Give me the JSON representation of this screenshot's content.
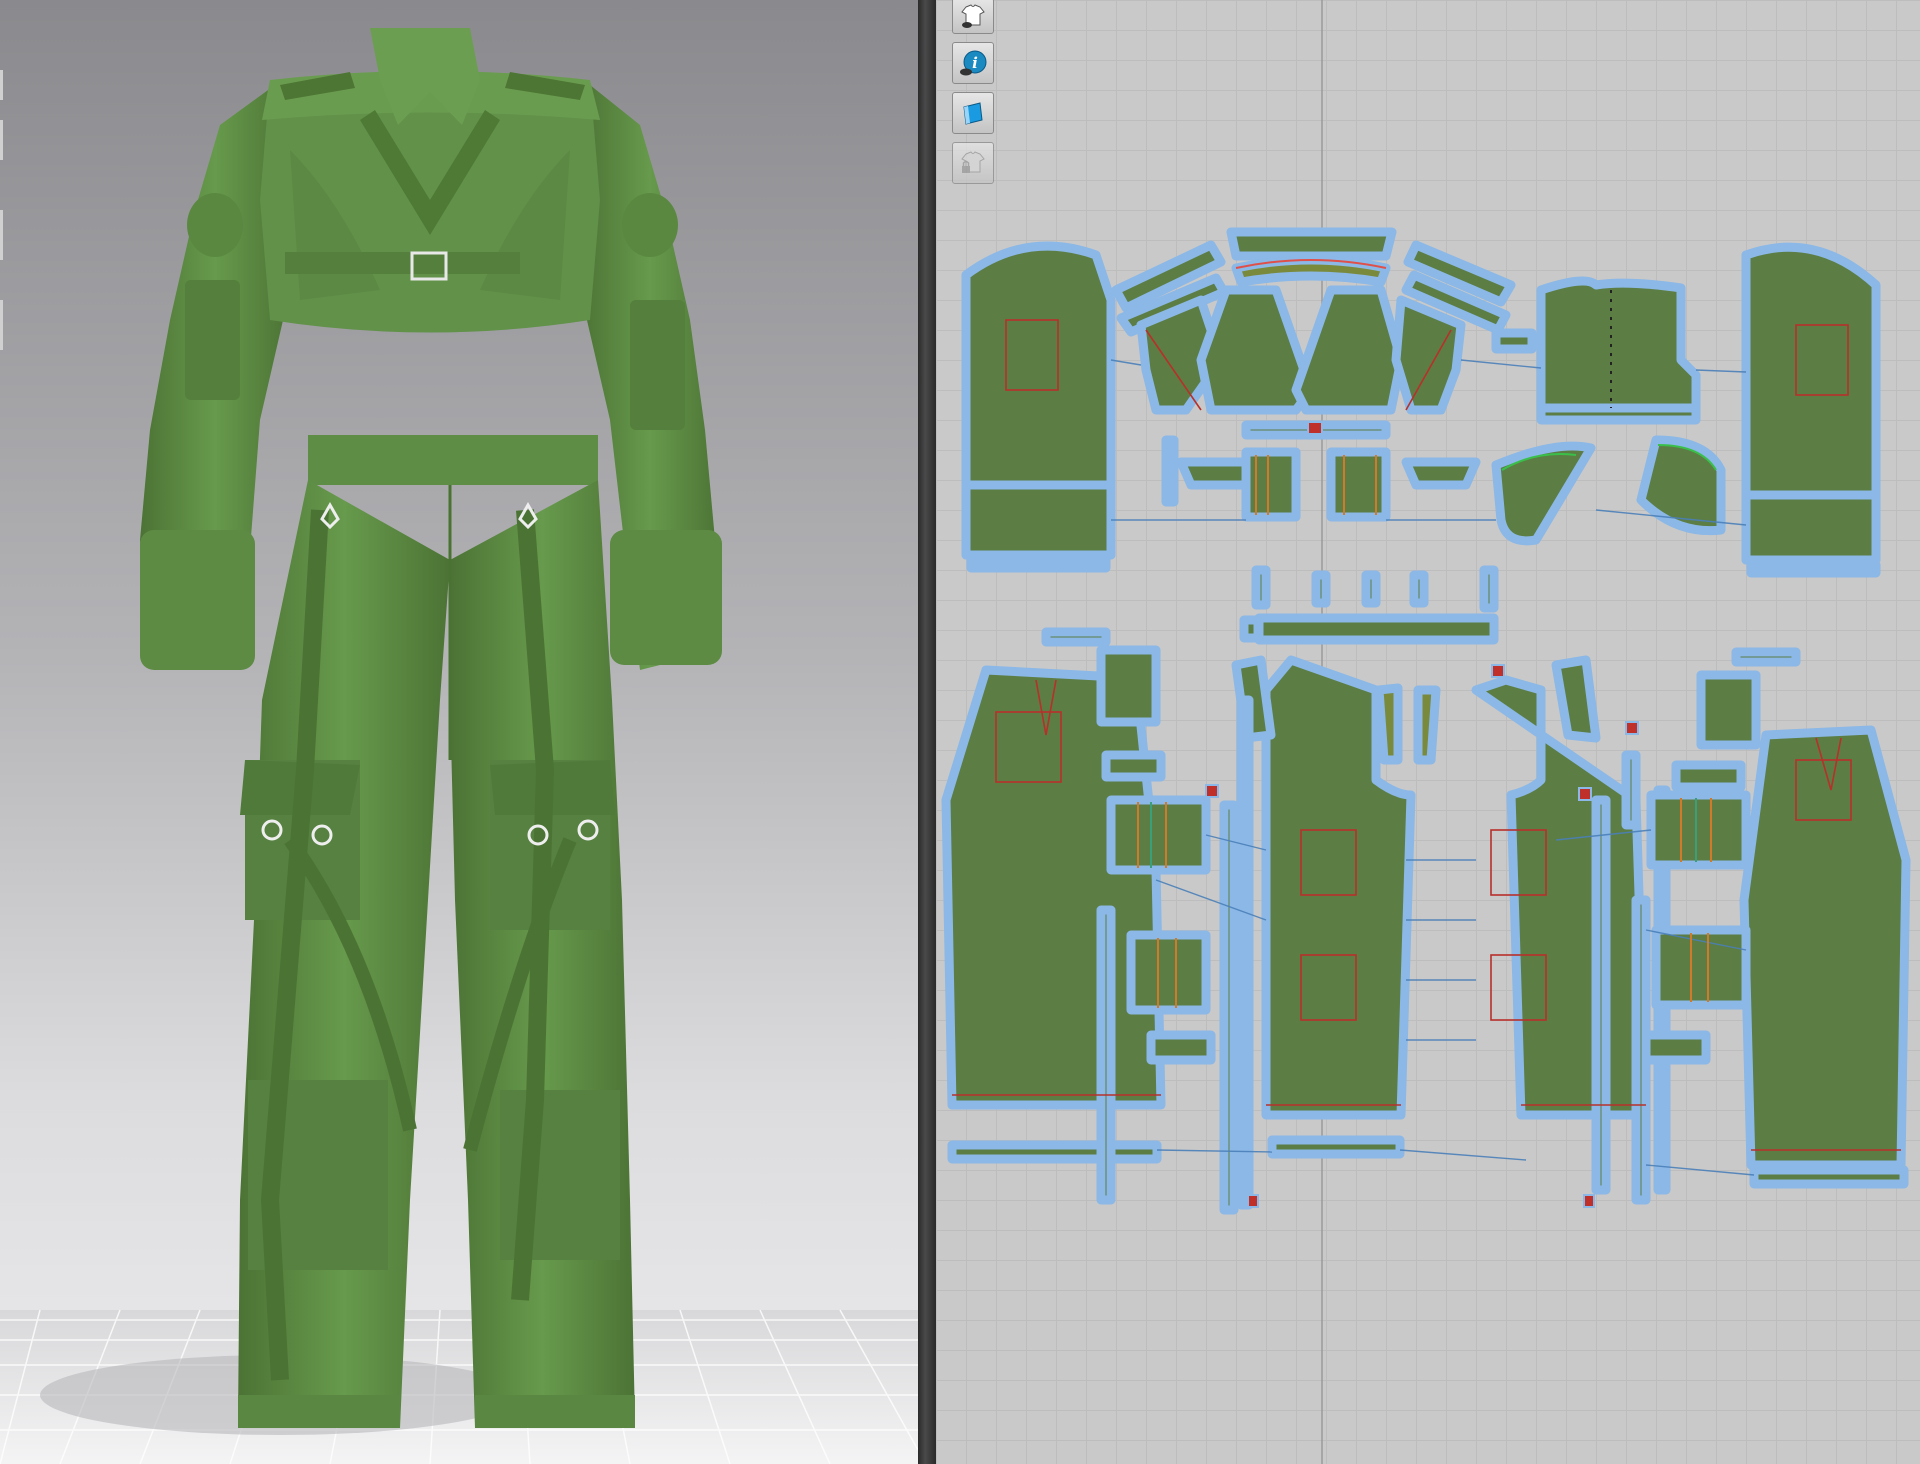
{
  "colors": {
    "fabric": "#5f8a45",
    "fabric_dark": "#4e7637",
    "fabric_light": "#6e9a52",
    "pattern_fill": "#5c7d44",
    "seam_allowance": "#8bb8e6",
    "internal_line": "#b8302a",
    "sewing_line": "#3a78b8",
    "grid": "#bdbdbd",
    "hardware": "#e8e8e8"
  },
  "icons": {
    "toolbar_2d": [
      "show-garment-icon",
      "show-info-icon",
      "show-texture-icon",
      "lock-garment-icon"
    ]
  },
  "garment": {
    "top": "cropped-jacket",
    "bottom": "cargo-pants"
  }
}
